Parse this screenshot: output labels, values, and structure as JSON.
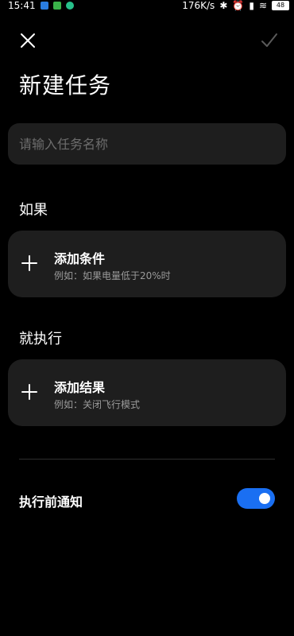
{
  "status_bar": {
    "time": "15:41",
    "net_speed": "176K/s",
    "battery": "48"
  },
  "header": {
    "close_icon": "close-icon",
    "confirm_icon": "check-icon",
    "title": "新建任务"
  },
  "task_name": {
    "value": "",
    "placeholder": "请输入任务名称"
  },
  "condition": {
    "section_label": "如果",
    "title": "添加条件",
    "example": "例如：如果电量低于20%时"
  },
  "result": {
    "section_label": "就执行",
    "title": "添加结果",
    "example": "例如：关闭飞行模式"
  },
  "notify": {
    "label": "执行前通知",
    "enabled": true
  },
  "colors": {
    "background": "#000000",
    "card": "#1e1e1e",
    "accent": "#1a6ff2",
    "muted_text": "#9a9a9a"
  }
}
